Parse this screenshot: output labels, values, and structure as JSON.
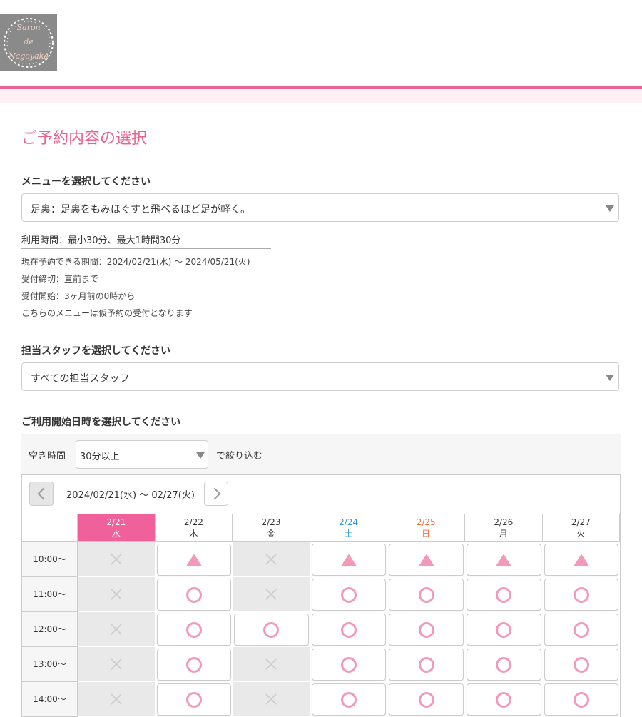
{
  "brand": {
    "logo_lines": [
      "Saron",
      "de",
      "Nagoyaka"
    ]
  },
  "page": {
    "title": "ご予約内容の選択"
  },
  "menu": {
    "label": "メニューを選択してください",
    "selected": "足裏：足裏をもみほぐすと飛べるほど足が軽く。",
    "usage_time": "利用時間：最小30分、最大1時間30分",
    "details": [
      "現在予約できる期間：2024/02/21(水) 〜 2024/05/21(火)",
      "受付締切：直前まで",
      "受付開始：3ヶ月前の0時から",
      "こちらのメニューは仮予約の受付となります"
    ]
  },
  "staff": {
    "label": "担当スタッフを選択してください",
    "selected": "すべての担当スタッフ"
  },
  "datetime": {
    "label": "ご利用開始日時を選択してください",
    "filter_label": "空き時間",
    "filter_value": "30分以上",
    "filter_suffix": "で絞り込む",
    "range": "2024/02/21(水) 〜 02/27(火)"
  },
  "calendar": {
    "days": [
      {
        "date": "2/21",
        "dow": "水",
        "kind": "today"
      },
      {
        "date": "2/22",
        "dow": "木",
        "kind": "weekday"
      },
      {
        "date": "2/23",
        "dow": "金",
        "kind": "weekday"
      },
      {
        "date": "2/24",
        "dow": "土",
        "kind": "sat"
      },
      {
        "date": "2/25",
        "dow": "日",
        "kind": "sun"
      },
      {
        "date": "2/26",
        "dow": "月",
        "kind": "weekday"
      },
      {
        "date": "2/27",
        "dow": "火",
        "kind": "weekday"
      }
    ],
    "times": [
      "10:00〜",
      "11:00〜",
      "12:00〜",
      "13:00〜",
      "14:00〜"
    ],
    "availability": [
      [
        "x",
        "tri",
        "x",
        "tri",
        "tri",
        "tri",
        "tri"
      ],
      [
        "x",
        "o",
        "x",
        "o",
        "o",
        "o",
        "o"
      ],
      [
        "x",
        "o",
        "o",
        "o",
        "o",
        "o",
        "o"
      ],
      [
        "x",
        "o",
        "x",
        "o",
        "o",
        "o",
        "o"
      ],
      [
        "x",
        "o",
        "x",
        "o",
        "o",
        "o",
        "o"
      ]
    ]
  },
  "colors": {
    "accent": "#e8648e",
    "today_bg": "#f0609a",
    "saturday": "#2a9bd6",
    "sunday": "#f26b3a",
    "mark": "#f29ab8"
  }
}
